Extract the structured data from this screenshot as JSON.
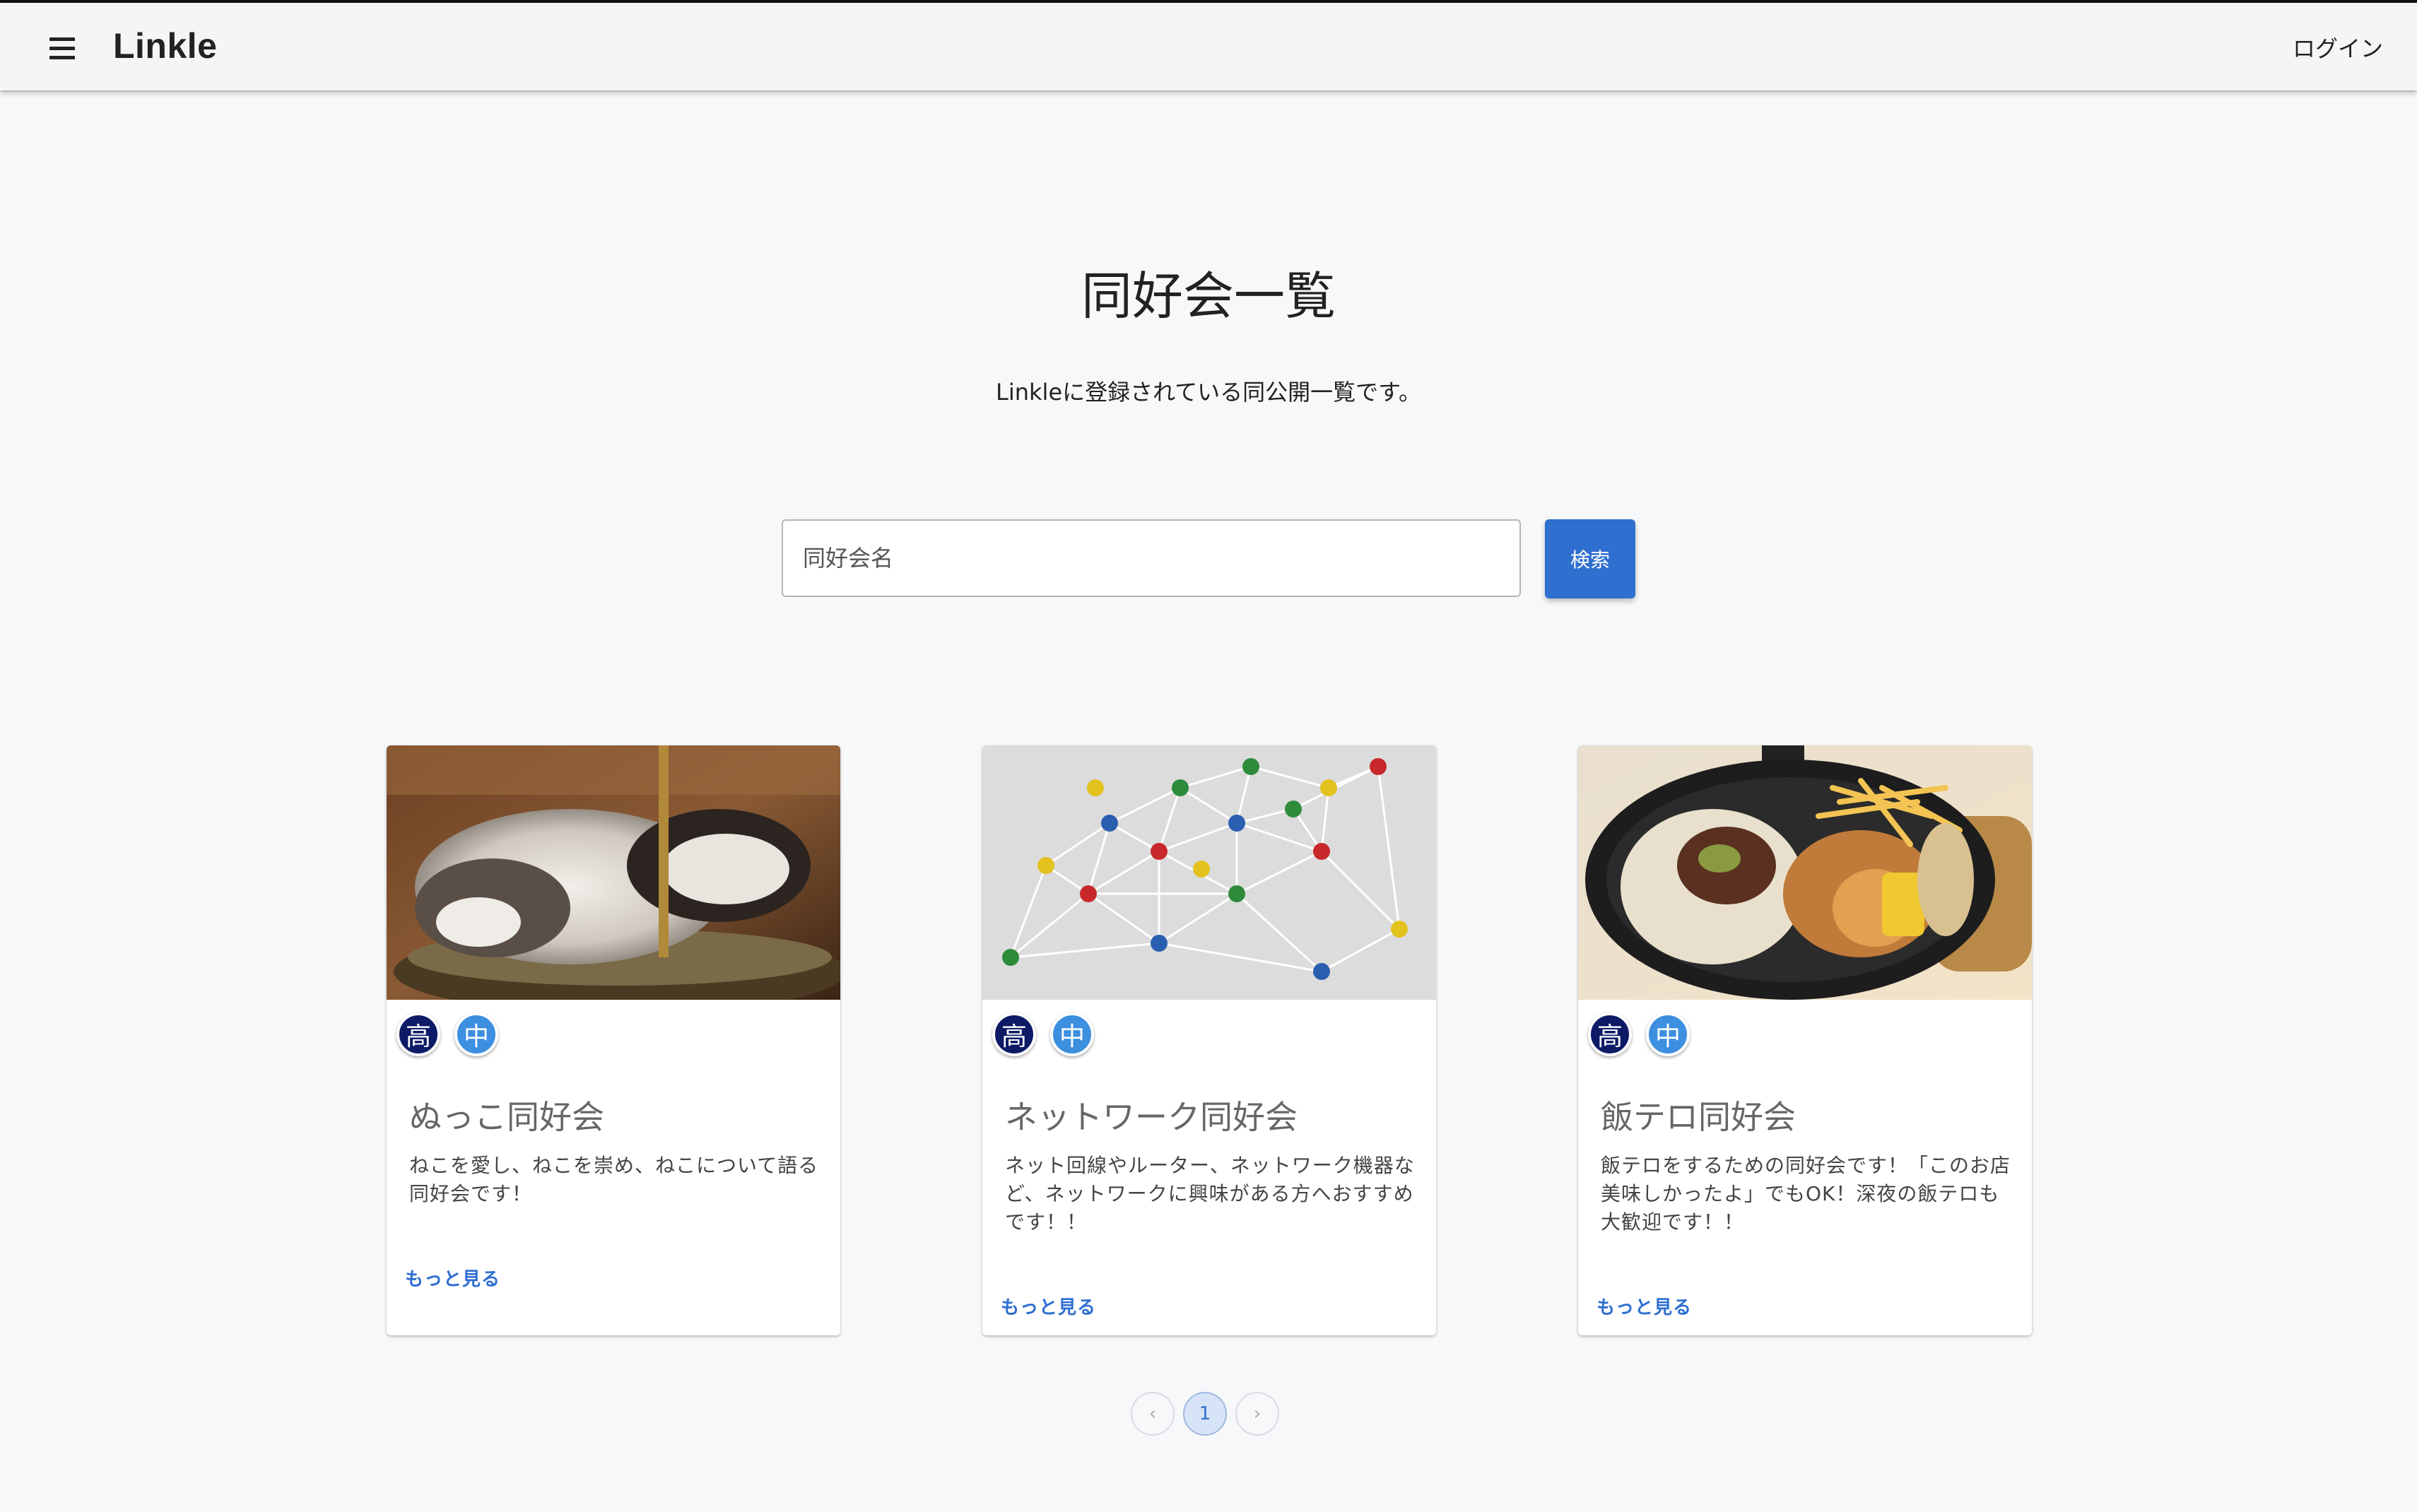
{
  "header": {
    "brand": "Linkle",
    "login_label": "ログイン"
  },
  "main": {
    "title": "同好会一覧",
    "description": "Linkleに登録されている同公開一覧です。"
  },
  "search": {
    "placeholder": "同好会名",
    "value": "",
    "button_label": "検索"
  },
  "cards": [
    {
      "image": "sleeping-cat-photo",
      "badges": [
        "高",
        "中"
      ],
      "title": "ぬっこ同好会",
      "description": "ねこを愛し、ねこを崇め、ねこについて語る同好会です！",
      "link_label": "もっと見る"
    },
    {
      "image": "network-pins-photo",
      "badges": [
        "高",
        "中"
      ],
      "title": "ネットワーク同好会",
      "description": "ネット回線やルーター、ネットワーク機器など、ネットワークに興味がある方へおすすめです！！",
      "link_label": "もっと見る"
    },
    {
      "image": "steak-rice-skillet-photo",
      "badges": [
        "高",
        "中"
      ],
      "title": "飯テロ同好会",
      "description": "飯テロをするための同好会です！「このお店美味しかったよ」でもOK！深夜の飯テロも大歓迎です！！",
      "link_label": "もっと見る"
    }
  ],
  "pagination": {
    "prev_icon": "chevron-left-icon",
    "current_page": "1",
    "next_icon": "chevron-right-icon"
  },
  "colors": {
    "primary": "#2f6fd0",
    "badge_high": "#0d1a66",
    "badge_mid": "#3d8fe0",
    "background": "#f7f8fa",
    "appbar": "#f5f5f5"
  }
}
